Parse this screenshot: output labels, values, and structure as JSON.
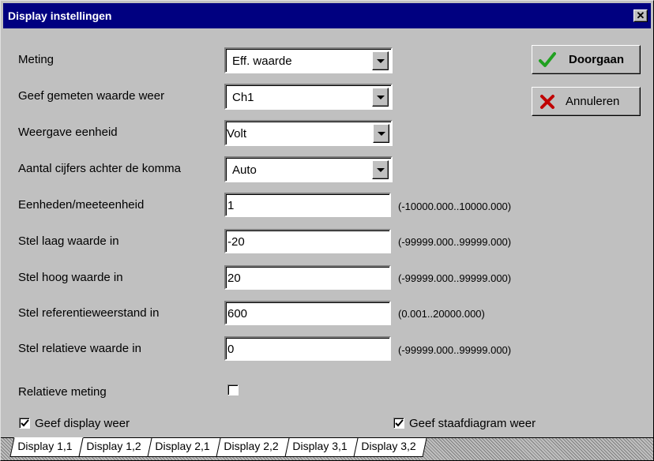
{
  "window": {
    "title": "Display instellingen",
    "close_glyph": "✕"
  },
  "form": {
    "meting": {
      "label": "Meting",
      "value": "Eff. waarde"
    },
    "geef_gemeten": {
      "label": "Geef gemeten waarde weer",
      "value": "Ch1"
    },
    "weergave_eenheid": {
      "label": "Weergave eenheid",
      "value": "Volt"
    },
    "aantal_cijfers": {
      "label": "Aantal cijfers achter de komma",
      "value": "Auto"
    },
    "eenheden": {
      "label": "Eenheden/meeteenheid",
      "value": "1",
      "range": "(-10000.000..10000.000)"
    },
    "laag": {
      "label": "Stel laag waarde in",
      "value": "-20",
      "range": "(-99999.000..99999.000)"
    },
    "hoog": {
      "label": "Stel hoog waarde in",
      "value": "20",
      "range": "(-99999.000..99999.000)"
    },
    "referentie": {
      "label": "Stel referentieweerstand in",
      "value": "600",
      "range": "(0.001..20000.000)"
    },
    "relatieve_waarde": {
      "label": "Stel relatieve waarde in",
      "value": "0",
      "range": "(-99999.000..99999.000)"
    },
    "relatieve_meting": {
      "label": "Relatieve meting",
      "checked": false
    },
    "geef_display": {
      "label": "Geef display weer",
      "checked": true
    },
    "geef_staafdiagram": {
      "label": "Geef staafdiagram weer",
      "checked": true
    }
  },
  "buttons": {
    "doorgaan": {
      "label": "Doorgaan",
      "icon": "checkmark-icon",
      "color": "#20a020"
    },
    "annuleren": {
      "label": "Annuleren",
      "icon": "red-x-icon",
      "color": "#c00000"
    }
  },
  "tabs": [
    {
      "label": "Display 1,1",
      "active": true
    },
    {
      "label": "Display 1,2",
      "active": false
    },
    {
      "label": "Display 2,1",
      "active": false
    },
    {
      "label": "Display 2,2",
      "active": false
    },
    {
      "label": "Display 3,1",
      "active": false
    },
    {
      "label": "Display 3,2",
      "active": false
    }
  ]
}
